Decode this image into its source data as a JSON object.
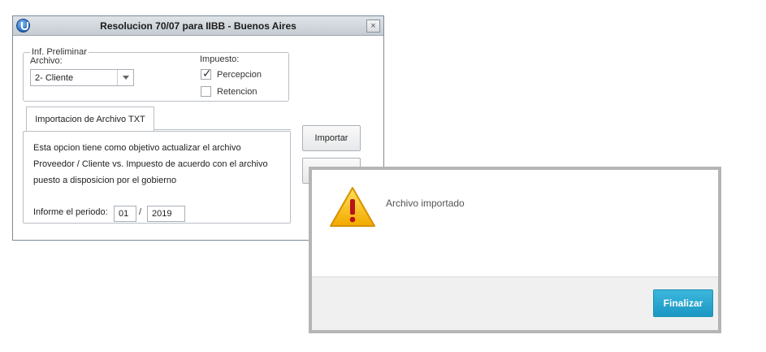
{
  "window": {
    "title": "Resolucion 70/07 para IIBB - Buenos Aires",
    "close_label": "×"
  },
  "group": {
    "legend": "Inf. Preliminar",
    "archivo_label": "Archivo:",
    "archivo_value": "2- Cliente",
    "impuesto_label": "Impuesto:",
    "options": [
      {
        "label": "Percepcion",
        "checked": true
      },
      {
        "label": "Retencion",
        "checked": false
      }
    ]
  },
  "tab": {
    "label": "Importacion de Archivo TXT"
  },
  "panel": {
    "lines": [
      "Esta opcion tiene como objetivo actualizar el archivo",
      "Proveedor / Cliente  vs. Impuesto de acuerdo con el archivo",
      "puesto a disposicion por el gobierno"
    ],
    "periodo_label": "Informe el periodo:",
    "mes": "01",
    "separator": "/",
    "anio": "2019"
  },
  "buttons": {
    "importar": "Importar"
  },
  "alert": {
    "message": "Archivo importado",
    "button": "Finalizar"
  },
  "colors": {
    "accent": "#1c97c4",
    "warning": "#f5b800"
  }
}
